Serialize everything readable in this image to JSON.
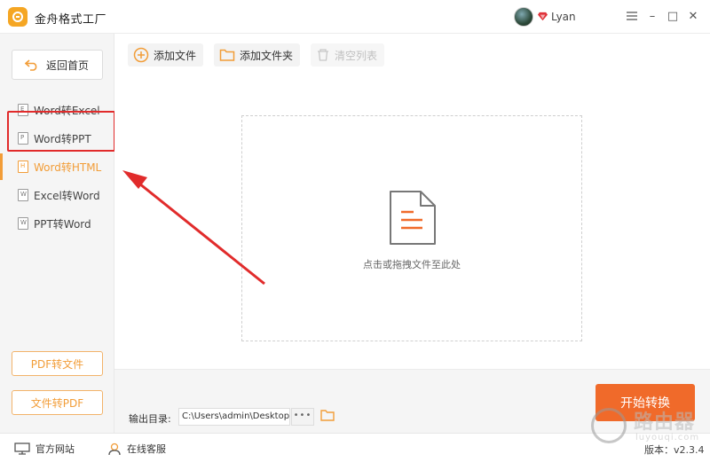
{
  "app": {
    "title": "金舟格式工厂",
    "username": "Lyan",
    "colors": {
      "accent": "#f29d38",
      "primary_button": "#f06a2a",
      "annotation": "#e12b2b"
    }
  },
  "window_controls": {
    "menu_icon": "hamburger-icon",
    "minimize": "–",
    "maximize": "□",
    "close": "✕"
  },
  "sidebar": {
    "back_label": "返回首页",
    "items": [
      {
        "label": "Word转Excel",
        "icon": "E",
        "active": false
      },
      {
        "label": "Word转PPT",
        "icon": "P",
        "active": false
      },
      {
        "label": "Word转HTML",
        "icon": "H",
        "active": true
      },
      {
        "label": "Excel转Word",
        "icon": "W",
        "active": false
      },
      {
        "label": "PPT转Word",
        "icon": "W",
        "active": false
      }
    ],
    "bottom_buttons": [
      "PDF转文件",
      "文件转PDF"
    ]
  },
  "toolbar": {
    "add_file": "添加文件",
    "add_folder": "添加文件夹",
    "clear_list": "清空列表"
  },
  "dropzone": {
    "text": "点击或拖拽文件至此处"
  },
  "output": {
    "label": "输出目录:",
    "path": "C:\\Users\\admin\\Desktop",
    "more": "•••"
  },
  "start_button": "开始转换",
  "statusbar": {
    "website": "官方网站",
    "support": "在线客服",
    "version": "版本：v2.3.4"
  },
  "watermark": {
    "text": "路由器",
    "sub": "luyouqi.com"
  }
}
